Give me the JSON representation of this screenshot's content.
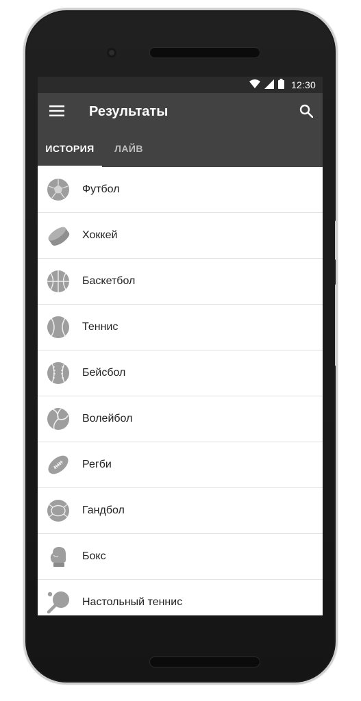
{
  "status_bar": {
    "time": "12:30",
    "icons": [
      "wifi-icon",
      "signal-icon",
      "battery-icon"
    ]
  },
  "app_bar": {
    "title": "Результаты",
    "menu_icon": "menu-icon",
    "search_icon": "search-icon"
  },
  "tabs": [
    {
      "label": "ИСТОРИЯ",
      "active": true
    },
    {
      "label": "ЛАЙВ",
      "active": false
    }
  ],
  "sports": [
    {
      "label": "Футбол",
      "icon": "soccer-ball-icon"
    },
    {
      "label": "Хоккей",
      "icon": "hockey-puck-icon"
    },
    {
      "label": "Баскетбол",
      "icon": "basketball-icon"
    },
    {
      "label": "Теннис",
      "icon": "tennis-ball-icon"
    },
    {
      "label": "Бейсбол",
      "icon": "baseball-icon"
    },
    {
      "label": "Волейбол",
      "icon": "volleyball-icon"
    },
    {
      "label": "Регби",
      "icon": "rugby-ball-icon"
    },
    {
      "label": "Гандбол",
      "icon": "handball-icon"
    },
    {
      "label": "Бокс",
      "icon": "boxing-glove-icon"
    },
    {
      "label": "Настольный теннис",
      "icon": "table-tennis-icon"
    }
  ],
  "colors": {
    "app_bar": "#424242",
    "status_bar": "#2b2b2b",
    "icon_gray": "#9e9e9e"
  }
}
